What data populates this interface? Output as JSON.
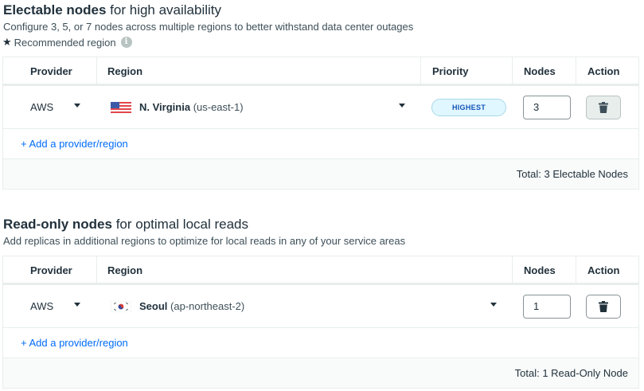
{
  "electable": {
    "title_bold": "Electable nodes",
    "title_rest": "for high availability",
    "subtitle": "Configure 3, 5, or 7 nodes across multiple regions to better withstand data center outages",
    "recommended_label": "Recommended region",
    "headers": {
      "provider": "Provider",
      "region": "Region",
      "priority": "Priority",
      "nodes": "Nodes",
      "action": "Action"
    },
    "row": {
      "provider": "AWS",
      "region_name": "N. Virginia",
      "region_code": "(us-east-1)",
      "priority": "HIGHEST",
      "nodes": "3",
      "flag_icon": "us-flag-icon"
    },
    "add_link": "+ Add a provider/region",
    "total": "Total: 3 Electable Nodes"
  },
  "readonly": {
    "title_bold": "Read-only nodes",
    "title_rest": "for optimal local reads",
    "subtitle": "Add replicas in additional regions to optimize for local reads in any of your service areas",
    "headers": {
      "provider": "Provider",
      "region": "Region",
      "nodes": "Nodes",
      "action": "Action"
    },
    "row": {
      "provider": "AWS",
      "region_name": "Seoul",
      "region_code": "(ap-northeast-2)",
      "nodes": "1",
      "flag_icon": "kr-flag-icon"
    },
    "add_link": "+ Add a provider/region",
    "total": "Total: 1 Read-Only Node"
  },
  "colors": {
    "link": "#016bf8",
    "badge_bg": "#e1f7ff",
    "badge_text": "#1254b7",
    "border": "#e7eeec"
  }
}
